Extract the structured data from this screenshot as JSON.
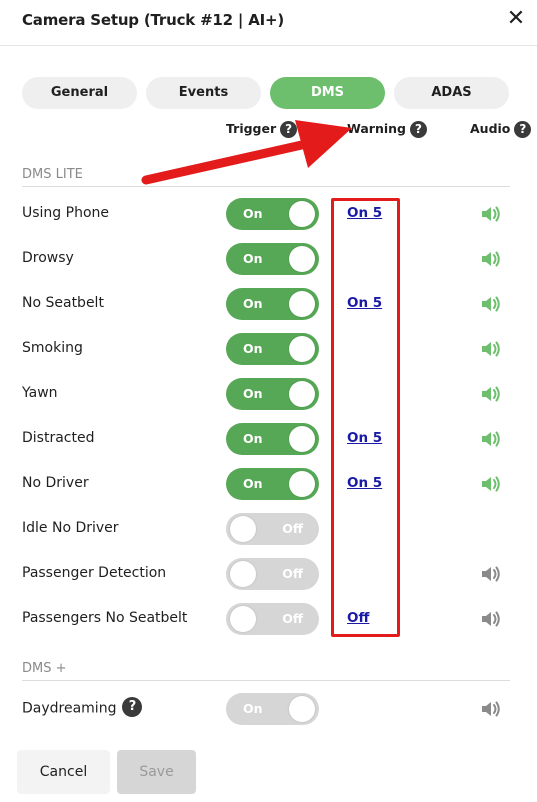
{
  "header": {
    "title": "Camera Setup (Truck #12 | AI+)",
    "close_label": "✕"
  },
  "tabs": [
    {
      "label": "General",
      "active": false
    },
    {
      "label": "Events",
      "active": false
    },
    {
      "label": "DMS",
      "active": true
    },
    {
      "label": "ADAS",
      "active": false
    }
  ],
  "columns": {
    "trigger": "Trigger",
    "warning": "Warning",
    "audio": "Audio",
    "help_glyph": "?"
  },
  "sections": {
    "dms_lite": "DMS LITE",
    "dms_plus": "DMS +"
  },
  "rows": [
    {
      "label": "Using Phone",
      "trigger": "On",
      "trigger_state": "on",
      "warning": "On 5",
      "audio": "green"
    },
    {
      "label": "Drowsy",
      "trigger": "On",
      "trigger_state": "on",
      "warning": "",
      "audio": "green"
    },
    {
      "label": "No Seatbelt",
      "trigger": "On",
      "trigger_state": "on",
      "warning": "On 5",
      "audio": "green"
    },
    {
      "label": "Smoking",
      "trigger": "On",
      "trigger_state": "on",
      "warning": "",
      "audio": "green"
    },
    {
      "label": "Yawn",
      "trigger": "On",
      "trigger_state": "on",
      "warning": "",
      "audio": "green"
    },
    {
      "label": "Distracted",
      "trigger": "On",
      "trigger_state": "on",
      "warning": "On 5",
      "audio": "green"
    },
    {
      "label": "No Driver",
      "trigger": "On",
      "trigger_state": "on",
      "warning": "On 5",
      "audio": "green"
    },
    {
      "label": "Idle No Driver",
      "trigger": "Off",
      "trigger_state": "off",
      "warning": "",
      "audio": "none"
    },
    {
      "label": "Passenger Detection",
      "trigger": "Off",
      "trigger_state": "off",
      "warning": "",
      "audio": "gray"
    },
    {
      "label": "Passengers No Seatbelt",
      "trigger": "Off",
      "trigger_state": "off",
      "warning": "Off",
      "audio": "gray"
    }
  ],
  "plus_rows": [
    {
      "label": "Daydreaming",
      "trigger": "On",
      "trigger_state": "disabled",
      "warning": "",
      "audio": "gray"
    }
  ],
  "footer": {
    "cancel_label": "Cancel",
    "save_label": "Save"
  },
  "colors": {
    "accent_green": "#56a856",
    "tab_active": "#6dbf6d",
    "annotation_red": "#e31b1b",
    "link_blue": "#1a1aa6"
  }
}
